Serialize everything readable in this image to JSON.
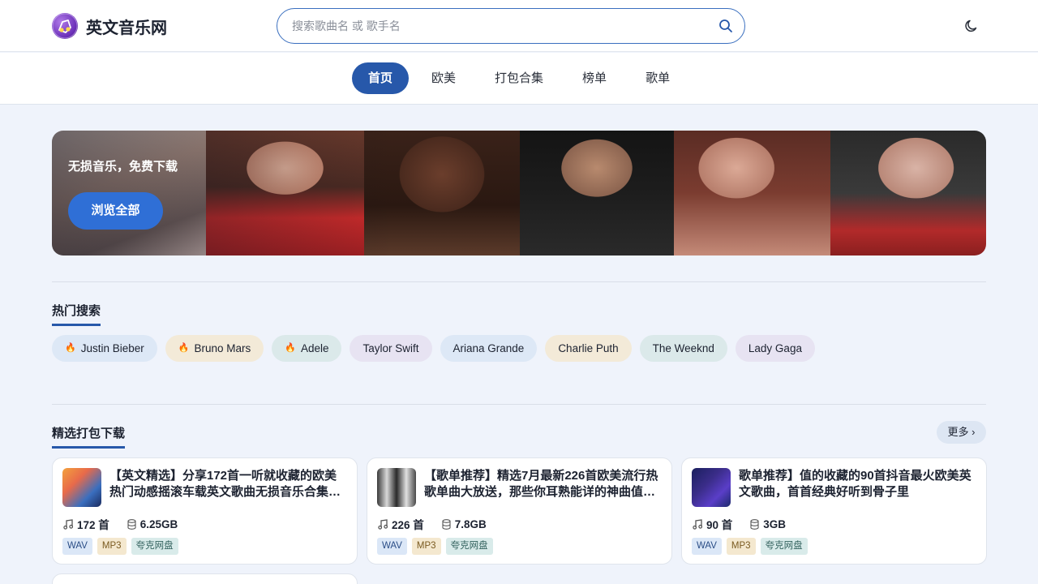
{
  "site": {
    "name": "英文音乐网"
  },
  "search": {
    "placeholder": "搜索歌曲名 或 歌手名"
  },
  "nav": {
    "items": [
      "首页",
      "欧美",
      "打包合集",
      "榜单",
      "歌单"
    ],
    "active": 0
  },
  "banner": {
    "tagline": "无损音乐，免费下载",
    "button_label": "浏览全部"
  },
  "hot_search": {
    "title": "热门搜索",
    "tags": [
      {
        "label": "Justin Bieber",
        "hot": true,
        "color": "#dde8f6"
      },
      {
        "label": "Bruno Mars",
        "hot": true,
        "color": "#f3ead8"
      },
      {
        "label": "Adele",
        "hot": true,
        "color": "#dbe9ea"
      },
      {
        "label": "Taylor Swift",
        "hot": false,
        "color": "#e7e3f2"
      },
      {
        "label": "Ariana Grande",
        "hot": false,
        "color": "#dde8f6"
      },
      {
        "label": "Charlie Puth",
        "hot": false,
        "color": "#f3ead8"
      },
      {
        "label": "The Weeknd",
        "hot": false,
        "color": "#dbe9ea"
      },
      {
        "label": "Lady Gaga",
        "hot": false,
        "color": "#e7e3f2"
      }
    ]
  },
  "featured": {
    "title": "精选打包下载",
    "more_label": "更多 ›",
    "cards": [
      {
        "title": "【英文精选】分享172首一听就收藏的欧美热门动感摇滚车载英文歌曲无损音乐合集，不容错过",
        "songs": "172 首",
        "size": "6.25GB",
        "badges": [
          "WAV",
          "MP3",
          "夸克网盘"
        ]
      },
      {
        "title": "【歌单推荐】精选7月最新226首欧美流行热歌单曲大放送，那些你耳熟能详的神曲值得收藏",
        "songs": "226 首",
        "size": "7.8GB",
        "badges": [
          "WAV",
          "MP3",
          "夸克网盘"
        ]
      },
      {
        "title": "歌单推荐】值的收藏的90首抖音最火欧美英文歌曲，首首经典好听到骨子里",
        "songs": "90 首",
        "size": "3GB",
        "badges": [
          "WAV",
          "MP3",
          "夸克网盘"
        ]
      }
    ]
  },
  "colors": {
    "accent": "#2758aa",
    "button": "#2f6fd6",
    "background": "#eff3fb"
  }
}
